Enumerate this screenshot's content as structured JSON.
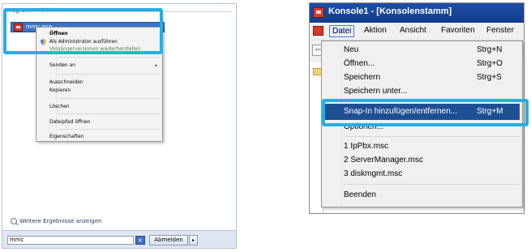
{
  "start_menu": {
    "group_header": "Programme (1)",
    "result": {
      "label": "mmc.exe",
      "icon": "mmc-app-icon"
    },
    "context_menu": {
      "items": [
        {
          "label": "Öffnen",
          "bold": true
        },
        {
          "label": "Als Administrator ausführen",
          "icon": "shield-icon"
        },
        {
          "label": "Vorgängerversionen wiederherstellen"
        },
        {
          "label": "Senden an",
          "submenu": true
        },
        {
          "label": "Ausschneiden"
        },
        {
          "label": "Kopieren"
        },
        {
          "label": "Löschen"
        },
        {
          "label": "Dateipfad öffnen"
        },
        {
          "label": "Eigenschaften"
        }
      ],
      "submenu_arrow": "▸"
    },
    "more_results": "Weitere Ergebnisse anzeigen",
    "search_value": "mmc",
    "clear_button": "✕",
    "shutdown_label": "Abmelden",
    "shutdown_arrow": "▸"
  },
  "console": {
    "title": "Konsole1 - [Konsolenstamm]",
    "menus": [
      "Datei",
      "Aktion",
      "Ansicht",
      "Favoriten",
      "Fenster"
    ],
    "active_menu": "Datei",
    "back_glyph": "⇦",
    "file_menu": {
      "items": [
        {
          "label": "Neu",
          "shortcut": "Strg+N"
        },
        {
          "label": "Öffnen...",
          "shortcut": "Strg+O"
        },
        {
          "label": "Speichern",
          "shortcut": "Strg+S"
        },
        {
          "label": "Speichern unter...",
          "shortcut": ""
        },
        {
          "label": "Snap-In hinzufügen/entfernen...",
          "shortcut": "Strg+M",
          "highlighted": true
        },
        {
          "label": "Optionen...",
          "shortcut": ""
        },
        {
          "label": "1 IpPbx.msc",
          "shortcut": ""
        },
        {
          "label": "2 ServerManager.msc",
          "shortcut": ""
        },
        {
          "label": "3 diskmgmt.msc",
          "shortcut": ""
        },
        {
          "label": "Beenden",
          "shortcut": ""
        }
      ]
    }
  },
  "colors": {
    "highlight_frame": "#27aee3",
    "title_bar": "#1d4ea7",
    "menu_selection": "#1f4f93",
    "result_selection": "#3a74c4"
  }
}
